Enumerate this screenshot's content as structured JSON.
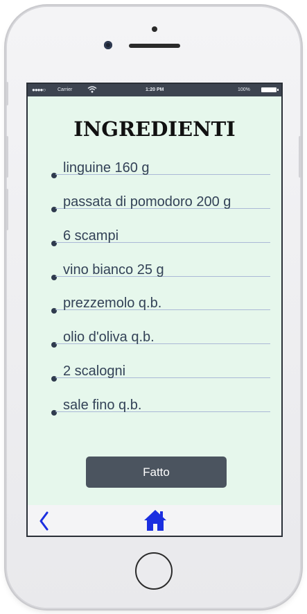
{
  "status_bar": {
    "signal": "●●●●○",
    "carrier": "Carrier",
    "time": "1:20 PM",
    "battery_percent": "100%"
  },
  "page_title": "INGREDIENTI",
  "ingredients": [
    "linguine 160 g",
    "passata di pomodoro 200 g",
    "6 scampi",
    "vino bianco 25 g",
    "prezzemolo q.b.",
    "olio d'oliva q.b.",
    "2 scalogni",
    "sale fino q.b."
  ],
  "done_button": "Fatto",
  "nav": {
    "back_icon": "chevron-left-icon",
    "home_icon": "home-icon"
  },
  "colors": {
    "screen_background": "#e6f7ec",
    "status_bar": "#3d4450",
    "button": "#4b545f",
    "nav_icons": "#1a2ee0"
  }
}
